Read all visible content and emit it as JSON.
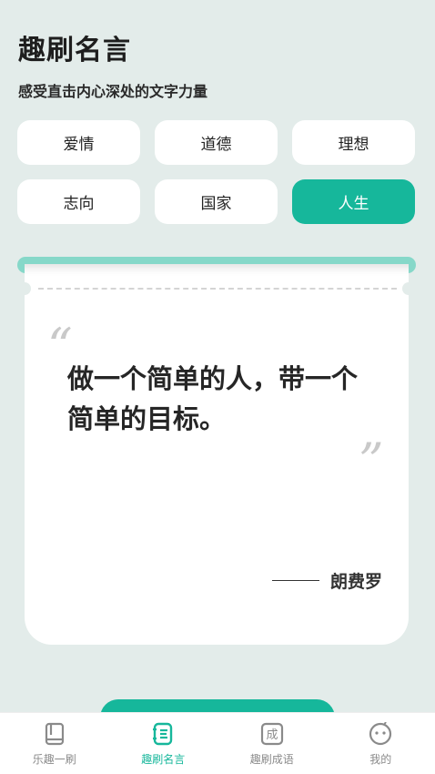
{
  "header": {
    "title": "趣刷名言",
    "subtitle": "感受直击内心深处的文字力量"
  },
  "categories": [
    {
      "label": "爱情",
      "active": false
    },
    {
      "label": "道德",
      "active": false
    },
    {
      "label": "理想",
      "active": false
    },
    {
      "label": "志向",
      "active": false
    },
    {
      "label": "国家",
      "active": false
    },
    {
      "label": "人生",
      "active": true
    }
  ],
  "quote": {
    "text": "做一个简单的人，带一个简单的目标。",
    "author_dash": "——",
    "author": "朗费罗"
  },
  "tabbar": {
    "items": [
      {
        "label": "乐趣一刷",
        "icon": "book-icon",
        "active": false
      },
      {
        "label": "趣刷名言",
        "icon": "quote-list-icon",
        "active": true
      },
      {
        "label": "趣刷成语",
        "icon": "idiom-icon",
        "icon_char": "成",
        "active": false
      },
      {
        "label": "我的",
        "icon": "profile-face-icon",
        "active": false
      }
    ]
  },
  "colors": {
    "accent": "#16b79b",
    "accent_light": "#86d8c9",
    "background": "#e3ecea",
    "inactive": "#8a8a8a"
  }
}
